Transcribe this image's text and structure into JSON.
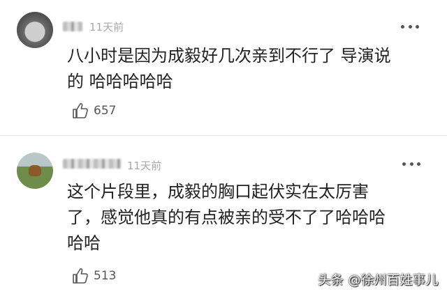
{
  "comments": [
    {
      "time": "11天前",
      "text_line1": "八小时是因为成毅好几次亲到不行了 导演说",
      "text_line2": "的 哈哈哈哈哈",
      "likes": "657",
      "icons": {
        "avatar": "user-avatar",
        "more": "more-dots-icon",
        "like": "thumbs-up-icon"
      }
    },
    {
      "time": "11天前",
      "text_line1": "这个片段里，成毅的胸口起伏实在太厉害",
      "text_line2": "了，感觉他真的有点被亲的受不了了哈哈哈",
      "text_line3": "哈哈",
      "likes": "513",
      "icons": {
        "avatar": "user-avatar",
        "more": "more-dots-icon",
        "like": "thumbs-up-icon"
      }
    }
  ],
  "watermark": "头条 @徐州百姓事儿"
}
